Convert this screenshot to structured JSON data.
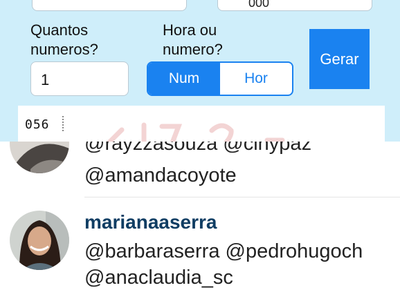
{
  "generator": {
    "top_left_value": "",
    "top_right_value": "000",
    "quantity_label": "Quantos numeros?",
    "mode_label": "Hora ou numero?",
    "quantity_value": "1",
    "mode_options": [
      "Num",
      "Hor"
    ],
    "mode_selected": "Num",
    "generate_label": "Gerar",
    "result": "056"
  },
  "comments": {
    "partial_comment": "@rayzzasouza @cinypaz",
    "partial_comment_line2": "@amandacoyote",
    "entry": {
      "username": "marianaaserra",
      "line1": "@barbaraserra @pedrohugoch",
      "line2": "@anaclaudia_sc"
    }
  },
  "colors": {
    "panel_bg": "#cfeefa",
    "accent": "#1a82f0",
    "username": "#0f3d63"
  }
}
